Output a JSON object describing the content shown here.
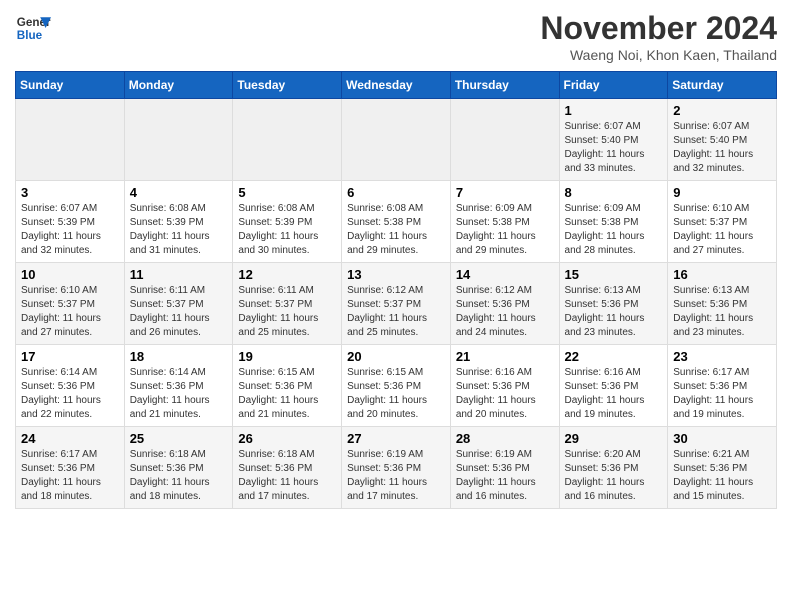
{
  "logo": {
    "line1": "General",
    "line2": "Blue"
  },
  "title": {
    "month_year": "November 2024",
    "location": "Waeng Noi, Khon Kaen, Thailand"
  },
  "weekdays": [
    "Sunday",
    "Monday",
    "Tuesday",
    "Wednesday",
    "Thursday",
    "Friday",
    "Saturday"
  ],
  "weeks": [
    [
      {
        "day": "",
        "info": ""
      },
      {
        "day": "",
        "info": ""
      },
      {
        "day": "",
        "info": ""
      },
      {
        "day": "",
        "info": ""
      },
      {
        "day": "",
        "info": ""
      },
      {
        "day": "1",
        "info": "Sunrise: 6:07 AM\nSunset: 5:40 PM\nDaylight: 11 hours and 33 minutes."
      },
      {
        "day": "2",
        "info": "Sunrise: 6:07 AM\nSunset: 5:40 PM\nDaylight: 11 hours and 32 minutes."
      }
    ],
    [
      {
        "day": "3",
        "info": "Sunrise: 6:07 AM\nSunset: 5:39 PM\nDaylight: 11 hours and 32 minutes."
      },
      {
        "day": "4",
        "info": "Sunrise: 6:08 AM\nSunset: 5:39 PM\nDaylight: 11 hours and 31 minutes."
      },
      {
        "day": "5",
        "info": "Sunrise: 6:08 AM\nSunset: 5:39 PM\nDaylight: 11 hours and 30 minutes."
      },
      {
        "day": "6",
        "info": "Sunrise: 6:08 AM\nSunset: 5:38 PM\nDaylight: 11 hours and 29 minutes."
      },
      {
        "day": "7",
        "info": "Sunrise: 6:09 AM\nSunset: 5:38 PM\nDaylight: 11 hours and 29 minutes."
      },
      {
        "day": "8",
        "info": "Sunrise: 6:09 AM\nSunset: 5:38 PM\nDaylight: 11 hours and 28 minutes."
      },
      {
        "day": "9",
        "info": "Sunrise: 6:10 AM\nSunset: 5:37 PM\nDaylight: 11 hours and 27 minutes."
      }
    ],
    [
      {
        "day": "10",
        "info": "Sunrise: 6:10 AM\nSunset: 5:37 PM\nDaylight: 11 hours and 27 minutes."
      },
      {
        "day": "11",
        "info": "Sunrise: 6:11 AM\nSunset: 5:37 PM\nDaylight: 11 hours and 26 minutes."
      },
      {
        "day": "12",
        "info": "Sunrise: 6:11 AM\nSunset: 5:37 PM\nDaylight: 11 hours and 25 minutes."
      },
      {
        "day": "13",
        "info": "Sunrise: 6:12 AM\nSunset: 5:37 PM\nDaylight: 11 hours and 25 minutes."
      },
      {
        "day": "14",
        "info": "Sunrise: 6:12 AM\nSunset: 5:36 PM\nDaylight: 11 hours and 24 minutes."
      },
      {
        "day": "15",
        "info": "Sunrise: 6:13 AM\nSunset: 5:36 PM\nDaylight: 11 hours and 23 minutes."
      },
      {
        "day": "16",
        "info": "Sunrise: 6:13 AM\nSunset: 5:36 PM\nDaylight: 11 hours and 23 minutes."
      }
    ],
    [
      {
        "day": "17",
        "info": "Sunrise: 6:14 AM\nSunset: 5:36 PM\nDaylight: 11 hours and 22 minutes."
      },
      {
        "day": "18",
        "info": "Sunrise: 6:14 AM\nSunset: 5:36 PM\nDaylight: 11 hours and 21 minutes."
      },
      {
        "day": "19",
        "info": "Sunrise: 6:15 AM\nSunset: 5:36 PM\nDaylight: 11 hours and 21 minutes."
      },
      {
        "day": "20",
        "info": "Sunrise: 6:15 AM\nSunset: 5:36 PM\nDaylight: 11 hours and 20 minutes."
      },
      {
        "day": "21",
        "info": "Sunrise: 6:16 AM\nSunset: 5:36 PM\nDaylight: 11 hours and 20 minutes."
      },
      {
        "day": "22",
        "info": "Sunrise: 6:16 AM\nSunset: 5:36 PM\nDaylight: 11 hours and 19 minutes."
      },
      {
        "day": "23",
        "info": "Sunrise: 6:17 AM\nSunset: 5:36 PM\nDaylight: 11 hours and 19 minutes."
      }
    ],
    [
      {
        "day": "24",
        "info": "Sunrise: 6:17 AM\nSunset: 5:36 PM\nDaylight: 11 hours and 18 minutes."
      },
      {
        "day": "25",
        "info": "Sunrise: 6:18 AM\nSunset: 5:36 PM\nDaylight: 11 hours and 18 minutes."
      },
      {
        "day": "26",
        "info": "Sunrise: 6:18 AM\nSunset: 5:36 PM\nDaylight: 11 hours and 17 minutes."
      },
      {
        "day": "27",
        "info": "Sunrise: 6:19 AM\nSunset: 5:36 PM\nDaylight: 11 hours and 17 minutes."
      },
      {
        "day": "28",
        "info": "Sunrise: 6:19 AM\nSunset: 5:36 PM\nDaylight: 11 hours and 16 minutes."
      },
      {
        "day": "29",
        "info": "Sunrise: 6:20 AM\nSunset: 5:36 PM\nDaylight: 11 hours and 16 minutes."
      },
      {
        "day": "30",
        "info": "Sunrise: 6:21 AM\nSunset: 5:36 PM\nDaylight: 11 hours and 15 minutes."
      }
    ]
  ]
}
